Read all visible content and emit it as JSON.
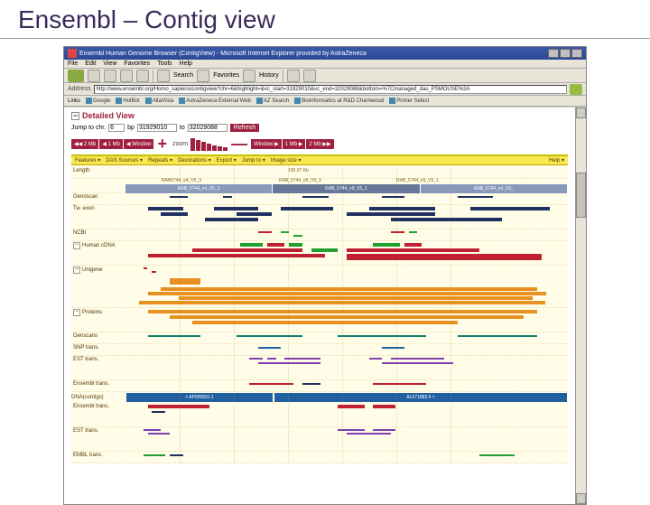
{
  "slide": {
    "title": "Ensembl – Contig view"
  },
  "titlebar": {
    "text": "Ensembl Human Genome Browser (ContigView) - Microsoft Internet Explorer provided by AstraZeneca"
  },
  "menu": {
    "file": "File",
    "edit": "Edit",
    "view": "View",
    "favorites": "Favorites",
    "tools": "Tools",
    "help": "Help"
  },
  "toolbar": {
    "back": "Back",
    "search": "Search",
    "favorites": "Favorites",
    "history": "History"
  },
  "address": {
    "label": "Address",
    "url": "http://www.ensembl.org/Homo_sapiens/contigview?chr=6&highlight=&vc_start=31929010&vc_end=32029088&bottom=%7Cmanaged_das_PSMOUSE%3A"
  },
  "links": {
    "label": "Links",
    "google": "Google",
    "hotbot": "HotBot",
    "altavista": "AltaVista",
    "azext": "AstraZeneca External Web",
    "azsearch": "AZ Search",
    "bioinf": "Bioinformatics at R&D Charnwood",
    "primer": "Primer Select"
  },
  "dv": {
    "header": "Detailed View",
    "jump_label": "Jump to chr.",
    "chr": "6",
    "bp_label": "bp",
    "bp_from": "31929010",
    "bp_to_label": "to",
    "bp_to": "32029088",
    "refresh": "Refresh"
  },
  "zoom": {
    "left2mb": "◀◀ 2 Mb",
    "left1mb": "◀ 1 Mb",
    "leftwin": "◀ Window",
    "label": "zoom",
    "rightwin": "Window ▶",
    "right1mb": "1 Mb ▶",
    "right2mb": "2 Mb ▶▶"
  },
  "ymenu": {
    "features": "Features ▾",
    "das": "DAS Sources ▾",
    "repeats": "Repeats ▾",
    "decorations": "Decorations ▾",
    "export": "Export ▾",
    "jump": "Jump to ▾",
    "imgsize": "Image size ▾",
    "help": "Help ▾"
  },
  "tracks": {
    "length": "Length",
    "length_val": "100.07 Kb",
    "genoscan": "Genoscan",
    "tw_exon": "Tw. exon",
    "ncbi": "NCBI",
    "cdna": "Human cDNA",
    "unigene": "Unigene",
    "protein": "Proteins",
    "genscans": "Genscans",
    "snp": "SNP trans.",
    "est": "EST trans.",
    "enstrans": "Ensembl trans.",
    "dnacontigs": "DNA(contigs)",
    "enstrans2": "Ensembl trans.",
    "esttrans2": "EST trans.",
    "embl": "EMBL trans.",
    "contig_a": "< AP000501.1",
    "contig_b": "AL671883.4 >",
    "gene_a": "RAB5744_v4_V5_3",
    "gene_b": "RAB_5744_v9_V9_3",
    "gene_c": "RAB_5744_v9_V9_1"
  }
}
